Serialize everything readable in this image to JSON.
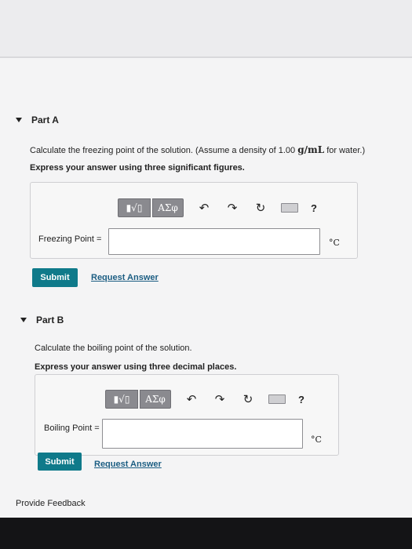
{
  "part_a": {
    "header": "Part A",
    "question_start": "Calculate the freezing point of the solution. (Assume a density of 1.00",
    "question_unit": "g/mL",
    "question_end": "for water.)",
    "instruction": "Express your answer using three significant figures.",
    "toolbar": {
      "template_label": "▮√▯",
      "symbols_label": "ΑΣφ",
      "help_label": "?"
    },
    "field_label": "Freezing Point =",
    "field_value": "",
    "unit": "°C",
    "submit_label": "Submit",
    "request_label": "Request Answer"
  },
  "part_b": {
    "header": "Part B",
    "question": "Calculate the boiling point of the solution.",
    "instruction": "Express your answer using three decimal places.",
    "toolbar": {
      "template_label": "▮√▯",
      "symbols_label": "ΑΣφ",
      "help_label": "?"
    },
    "field_label": "Boiling Point =",
    "field_value": "",
    "unit": "°C",
    "submit_label": "Submit",
    "request_label": "Request Answer"
  },
  "footer": {
    "feedback_label": "Provide Feedback"
  }
}
